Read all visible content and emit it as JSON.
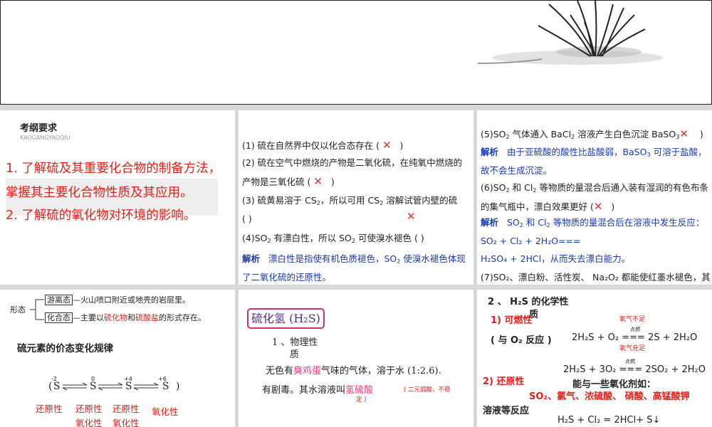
{
  "colors": {
    "accent_red": "#e0201a",
    "analysis_blue": "#1a3aa8",
    "pink": "#e0407a",
    "gap_gray": "#d9d9d9"
  },
  "p1": {
    "heading": "考纲要求",
    "heading_pinyin": "KAOGANGYAOQIU",
    "req1a": "1. 了解硫及其重要化合物的制备方法，",
    "req1b": "掌握其主要化合物性质及其应用。",
    "req2": "2. 了解硫的氧化物对环境的影响。"
  },
  "p2": {
    "q1": "(1) 硫在自然界中仅以化合态存在 (",
    "q1_end": ")",
    "q2a": "(2) 硫在空气中燃烧的产物是二氧化硫，在纯氧中燃烧的",
    "q2b": "产物是三氧化硫 (",
    "q2b_end": ")",
    "q3a_pre": "(3) 硫黄易溶于 CS",
    "q3a_mid": "，所以可用 CS",
    "q3a_post": " 溶解试管内壁的硫",
    "q3b": "(          )",
    "q4_pre": "(4)SO",
    "q4_post": " 有漂白性，所以 SO",
    "q4_post2": " 可使溴水褪色 (          )",
    "analysis_label": "解析",
    "a4_pre": "漂白性是指使有机色质褪色，SO",
    "a4_post": " 使溴水褪色体现",
    "a4b": "了二氧化硫的还原性。",
    "x": "✕",
    "sub2": "2"
  },
  "p3": {
    "q5_pre": "(5)SO",
    "q5_mid": " 气体通入 BaCl",
    "q5_mid2": " 溶液产生白色沉淀 BaSO",
    "q5_end": ")",
    "sub3": "3",
    "a5_label": "解析",
    "a5": "由于亚硫酸的酸性比盐酸弱，BaSO",
    "a5_post": " 可溶于盐酸，",
    "a5b": "故不会生成沉淀。",
    "q6_pre": "(6)SO",
    "q6_mid": " 和 Cl",
    "q6_post": " 等物质的量混合后通入装有湿润的有色布条",
    "q6b": "的集气瓶中，漂白效果更好 (",
    "q6b_end": ")",
    "a6_label": "解析",
    "a6_pre": "SO",
    "a6_mid": " 和 Cl",
    "a6_post": " 等物质的量混合后在溶液中发生反应：",
    "eq1": "SO₂ + Cl₂ + 2H₂O===",
    "eq2_pre": "H₂SO₄ + 2HCl",
    "eq2_post": "，从而失去漂白能力。",
    "q7": "(7)SO₂、漂白粉、活性炭、 Na₂O₂ 都能使红墨水褪色，其"
  },
  "p4": {
    "form_label": "形态",
    "free_state": "游离态",
    "free_desc": "—火山喷口附近或地壳的岩层里。",
    "combined_state": "化合态",
    "combined_pre": "—主要以",
    "sulfide": "硫化物",
    "and": "和",
    "sulfate": "硫酸盐",
    "combined_post": "的形式存在。",
    "valence_title": "硫元素的价态变化规律",
    "ox_m2": "-2",
    "ox_0": "0",
    "ox_p4": "+4",
    "ox_p6": "+6",
    "S": "S",
    "lp": "(",
    "rp": ")",
    "reduc": "还原性",
    "oxid": "氧化性"
  },
  "p5": {
    "title": "硫化氢 (H₂S)",
    "prop_label": "1 、物理性",
    "prop_label2": "质",
    "line1_pre": "无色有",
    "line1_red": "臭鸡蛋",
    "line1_post": "气味的气体，溶于水 (1:2.6).",
    "line2_pre": "有剧毒。其水溶液叫",
    "line2_red": "氢硫酸",
    "line2_note": "( 二元弱酸，不稳",
    "line2_note2": "定 )"
  },
  "p6": {
    "heading": "2 、 H₂S 的化学性",
    "heading2": "质",
    "flammable": "1) 可燃性",
    "with_o2": "( 与 O₂ 反应 )",
    "o2_insuff": "氧气不足",
    "eq_a_left": "2H₂S + O₂",
    "ignite": "点燃",
    "eq_a_arrow": "===",
    "eq_a_right": "2S + 2H₂O",
    "o2_suff": "氧气充足",
    "eq_b_left": "2H₂S + 3O₂",
    "eq_b_right": "2SO₂ + 2H₂O",
    "reducing": "2) 还原性",
    "oxidants": "能与一些氧化剂如：",
    "oxidant_list": "SO₂、氯气、浓硫酸、 硝酸、高锰酸钾",
    "solution_etc": "溶液等反应",
    "eq_c": "H₂S + Cl₂ = 2HCl+ S↓"
  }
}
